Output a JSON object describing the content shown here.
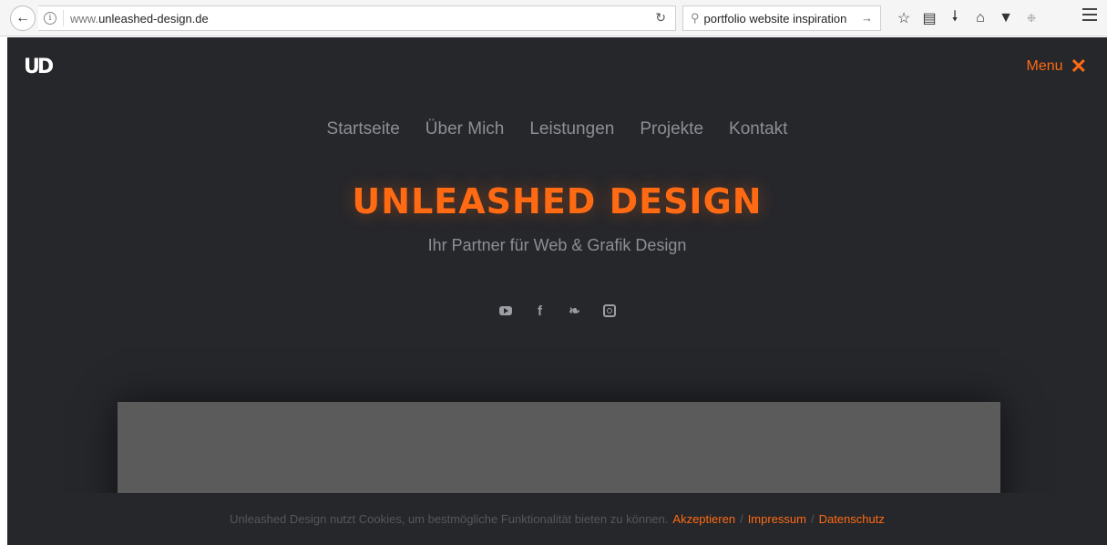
{
  "browser": {
    "url_prefix": "www.",
    "url_domain": "unleashed-design.de",
    "search_query": "portfolio website inspiration",
    "icons": [
      "star-icon",
      "reading-list-icon",
      "download-icon",
      "home-icon",
      "pocket-icon",
      "extension-icon",
      "menu-icon"
    ]
  },
  "site": {
    "logo": "UD",
    "menu_label": "Menu",
    "menu_close": "✕",
    "nav": [
      "Startseite",
      "Über Mich",
      "Leistungen",
      "Projekte",
      "Kontakt"
    ],
    "title": "UNLEASHED DESIGN",
    "subtitle": "Ihr Partner für Web & Grafik Design",
    "social": [
      "youtube-icon",
      "facebook-icon",
      "twitter-icon",
      "instagram-icon"
    ],
    "cookie": {
      "text": "Unleashed Design nutzt Cookies, um bestmögliche Funktionalität bieten zu können.",
      "accept": "Akzeptieren",
      "sep": "/",
      "impressum": "Impressum",
      "datenschutz": "Datenschutz"
    }
  },
  "colors": {
    "accent": "#ff6a13",
    "background": "#26272b"
  }
}
